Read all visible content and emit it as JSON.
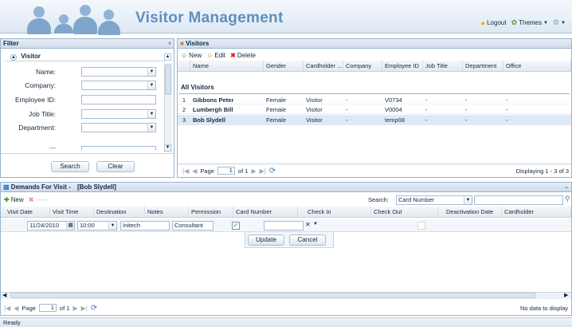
{
  "header": {
    "title": "Visitor Management",
    "links": [
      {
        "label": "Logout",
        "icon": "lock-icon"
      },
      {
        "label": "Themes",
        "icon": "leaf-icon"
      }
    ]
  },
  "filter": {
    "panel_title": "Filter",
    "group_title": "Visitor",
    "fields": [
      {
        "label": "Name:",
        "value": ""
      },
      {
        "label": "Company:",
        "value": ""
      },
      {
        "label": "Employee ID:",
        "value": ""
      },
      {
        "label": "Job Title:",
        "value": ""
      },
      {
        "label": "Department:",
        "value": ""
      },
      {
        "label": "----",
        "value": ""
      }
    ],
    "search_label": "Search",
    "clear_label": "Clear"
  },
  "visitors": {
    "panel_title": "Visitors",
    "toolbar": {
      "new": "New",
      "edit": "Edit",
      "delete": "Delete"
    },
    "columns": [
      "Name",
      "Gender",
      "Cardholder ...",
      "Company",
      "Employee ID",
      "Job Title",
      "Department",
      "Office"
    ],
    "group_label": "All Visitors",
    "rows": [
      {
        "num": "1",
        "cells": [
          "Gibbons Peter",
          "Female",
          "Visitor",
          "-",
          "V0734",
          "-",
          "-",
          "-"
        ]
      },
      {
        "num": "2",
        "cells": [
          "Lumbergh Bill",
          "Female",
          "Visitor",
          "-",
          "V0004",
          "-",
          "-",
          "-"
        ]
      },
      {
        "num": "3",
        "cells": [
          "Bob Slydell",
          "Female",
          "Visitor",
          "-",
          "temp08",
          "-",
          "-",
          "-"
        ]
      }
    ],
    "pager": {
      "page_label": "Page",
      "page": "1",
      "of_label": "of 1",
      "displaying": "Displaying 1 - 3 of 3"
    }
  },
  "demands": {
    "panel_title": "Demands For Visit -",
    "panel_subject": "[Bob Slydell]",
    "toolbar": {
      "new": "New"
    },
    "search_label": "Search:",
    "search_field": "Card Number",
    "columns": [
      "Visit Date",
      "Visit Time",
      "Destination",
      "Notes",
      "Permission",
      "Card Number",
      "Check In",
      "Check Out",
      "Deactivation Date",
      "Cardholder"
    ],
    "editor": {
      "visit_date": "11/24/2010",
      "visit_time": "10:00",
      "destination": "Initech",
      "notes": "Consultant"
    },
    "update_label": "Update",
    "cancel_label": "Cancel",
    "pager": {
      "page_label": "Page",
      "page": "1",
      "of_label": "of 1",
      "empty": "No data to display"
    }
  },
  "status": {
    "text": "Ready"
  }
}
